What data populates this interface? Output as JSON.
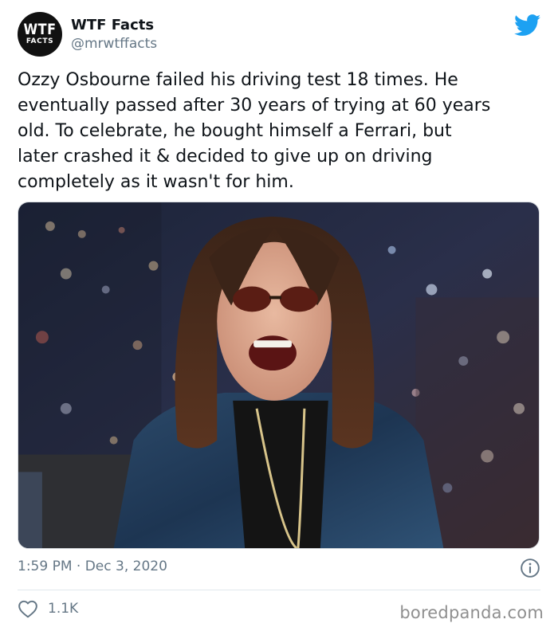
{
  "author": {
    "avatar_text_top": "WTF",
    "avatar_text_bottom": "FACTS",
    "display_name": "WTF Facts",
    "handle": "@mrwtffacts"
  },
  "tweet": {
    "text": "Ozzy Osbourne failed his driving test 18 times. He\neventually passed after 30 years of trying at 60 years\nold. To celebrate, he bought himself a Ferrari, but\nlater crashed it & decided to give up on driving\ncompletely as it wasn't for him.",
    "timestamp": "1:59 PM · Dec 3, 2020",
    "like_count": "1.1K"
  },
  "icons": {
    "brand": "twitter-bird-icon",
    "info": "info-icon",
    "like": "heart-icon"
  },
  "colors": {
    "twitter_blue": "#1DA1F2",
    "secondary_text": "#657786",
    "avatar_bg": "#111111"
  },
  "watermark": "boredpanda.com"
}
